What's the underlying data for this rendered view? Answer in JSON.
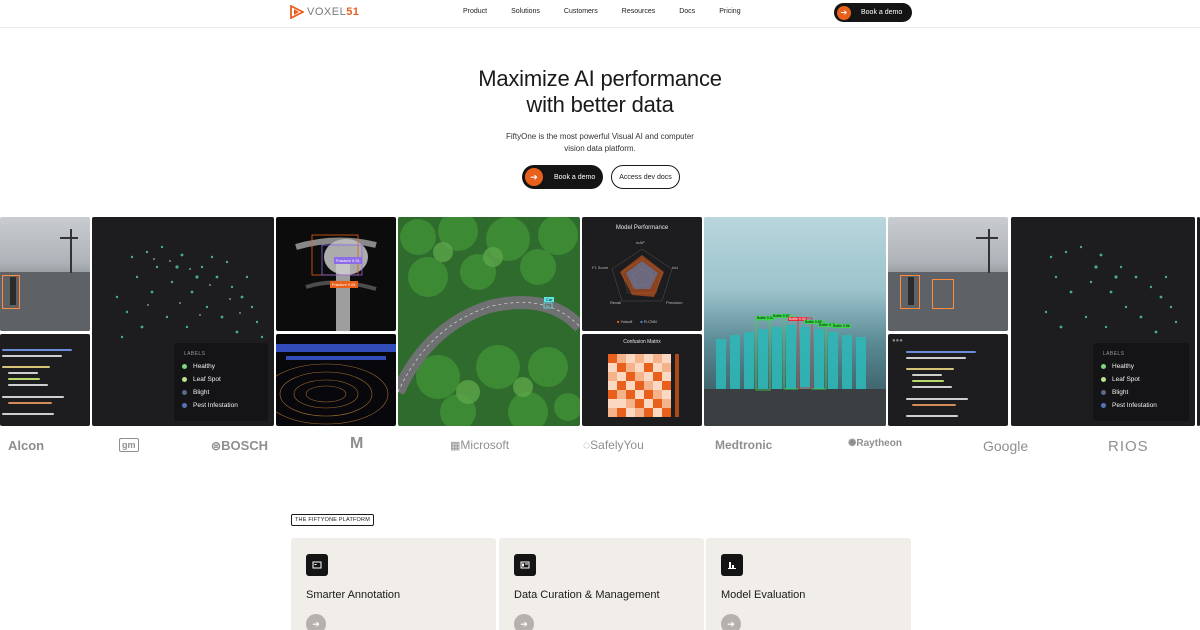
{
  "brand": {
    "name_prefix": "VOXEL",
    "name_suffix": "51",
    "accent": "#e8601c"
  },
  "nav": {
    "links": [
      "Product",
      "Solutions",
      "Customers",
      "Resources",
      "Docs",
      "Pricing"
    ],
    "cta": "Book a demo"
  },
  "hero": {
    "title_line1": "Maximize AI performance",
    "title_line2": "with better data",
    "subtitle_line1": "FiftyOne is the most powerful Visual AI and computer",
    "subtitle_line2": "vision data platform.",
    "primary_button": "Book a demo",
    "secondary_button": "Access dev docs"
  },
  "gallery": {
    "detection_labels": [
      "Fracture 0.91",
      "Fracture 0.61"
    ],
    "road_label": "Car",
    "legend": {
      "title": "LABELS",
      "items": [
        {
          "label": "Healthy",
          "color": "#7bd67e"
        },
        {
          "label": "Leaf Spot",
          "color": "#b9e38e"
        },
        {
          "label": "Blight",
          "color": "#5a6b8c"
        },
        {
          "label": "Pest Infestation",
          "color": "#5574b8"
        }
      ]
    },
    "model_performance": {
      "title": "Model Performance",
      "axes": [
        "mAP",
        "IoU",
        "Precision",
        "Recall",
        "F1 Score"
      ],
      "series": [
        {
          "name": "Yolov8",
          "color": "#e8601c"
        },
        {
          "name": "R-CNN",
          "color": "#4b8fe0"
        }
      ]
    },
    "confusion_matrix": {
      "title": "Confusion Matrix"
    },
    "bottle_labels": [
      "Bottle 0.92",
      "Bottle 0.87",
      "Bottle 0.94",
      "Bottle 0.89",
      "Bottle 0.91",
      "Bottle 0.86"
    ]
  },
  "logos": [
    "Alcon",
    "gm",
    "BOSCH",
    "M",
    "Microsoft",
    "SafelyYou",
    "Medtronic",
    "Raytheon",
    "Google",
    "RIOS"
  ],
  "platform": {
    "tag": "THE FIFTYONE PLATFORM",
    "cards": [
      {
        "title": "Smarter Annotation"
      },
      {
        "title": "Data Curation & Management"
      },
      {
        "title": "Model Evaluation"
      }
    ]
  }
}
